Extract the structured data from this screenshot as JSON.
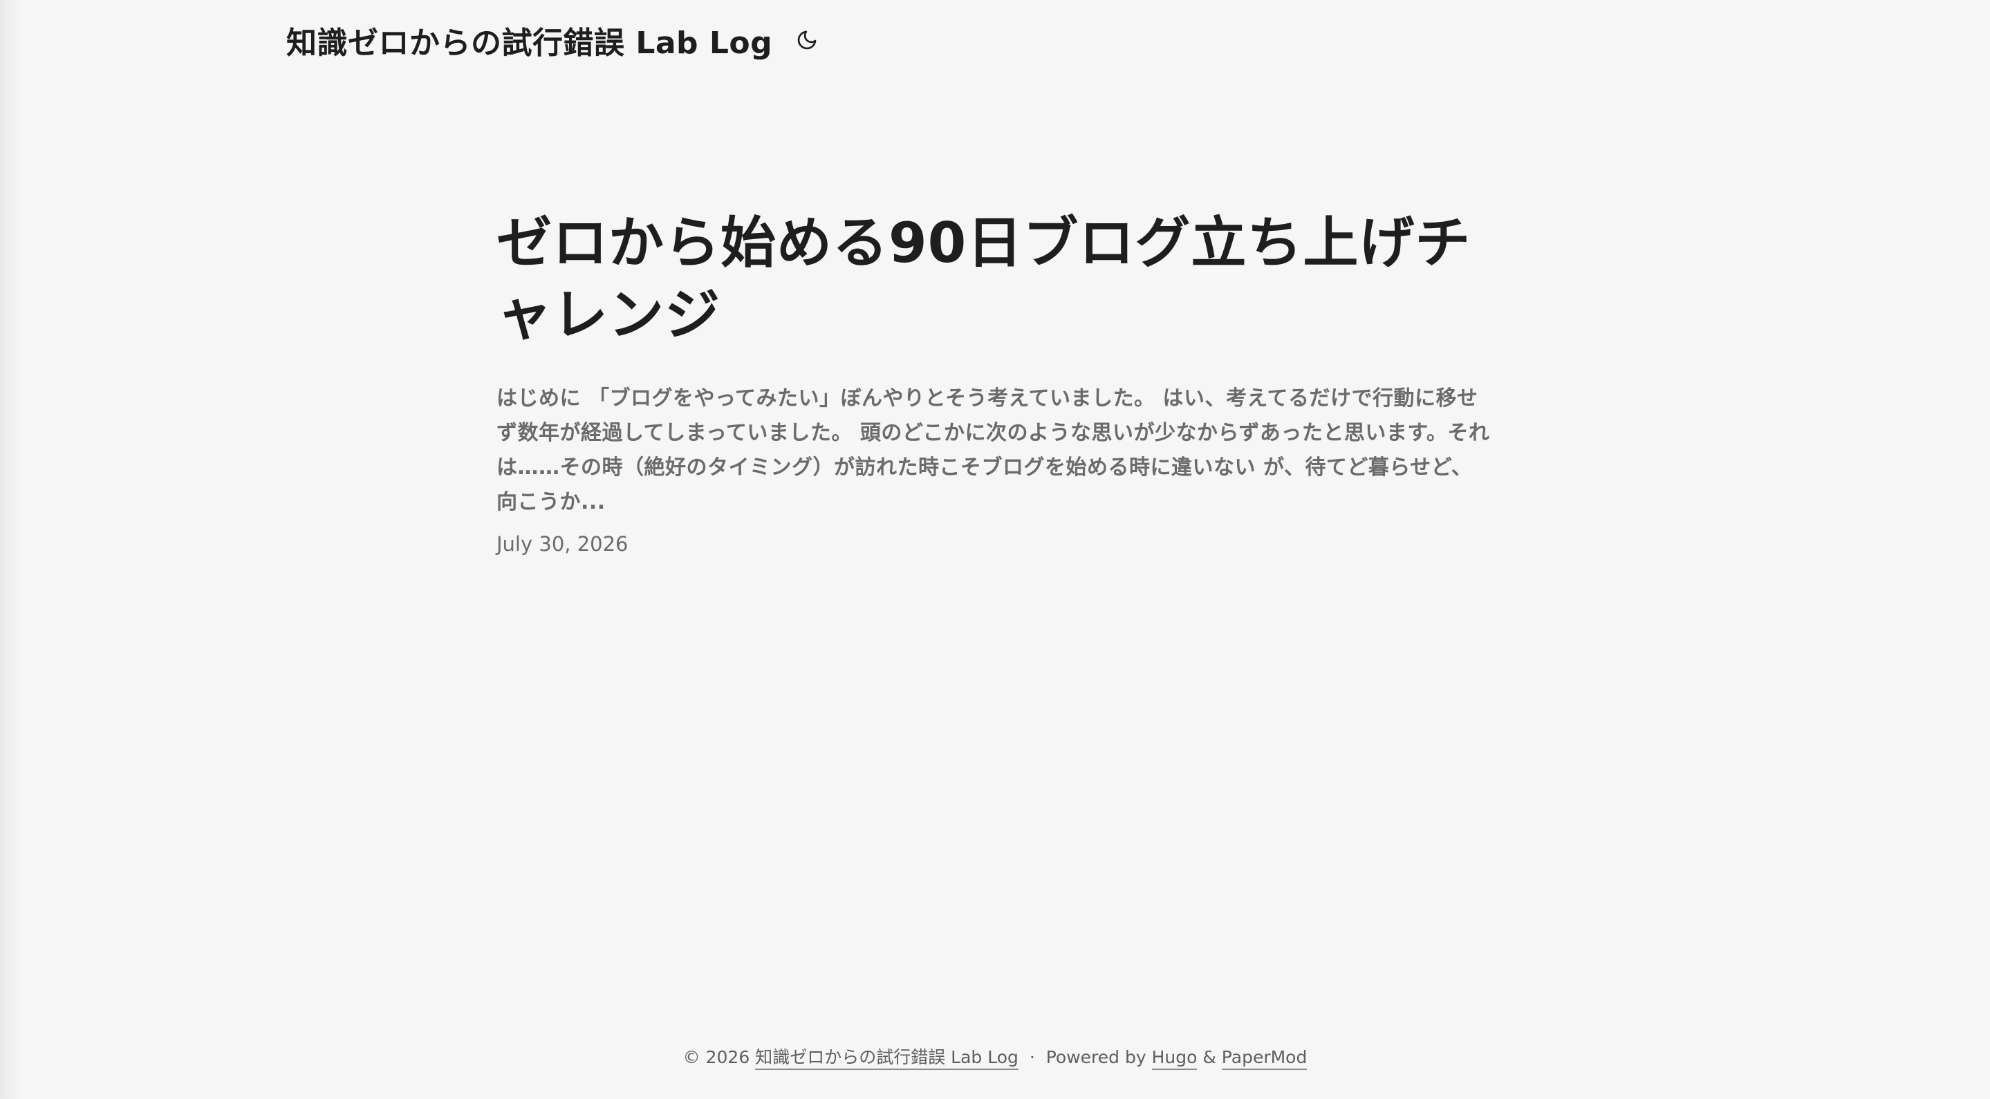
{
  "header": {
    "site_title": "知識ゼロからの試行錯誤 Lab Log",
    "theme_toggle_icon": "moon-icon"
  },
  "post": {
    "title": "ゼロから始める90日ブログ立ち上げチャレンジ",
    "summary": "はじめに 「ブログをやってみたい」ぼんやりとそう考えていました。 はい、考えてるだけで行動に移せず数年が経過してしまっていました。 頭のどこかに次のような思いが少なからずあったと思います。それは……その時（絶好のタイミング）が訪れた時こそブログを始める時に違いない が、待てど暮らせど、向こうか...",
    "date": "July 30, 2026"
  },
  "footer": {
    "copyright": "© 2026",
    "site_link": "知識ゼロからの試行錯誤 Lab Log",
    "separator": "·",
    "powered_by": "Powered by",
    "hugo_link": "Hugo",
    "ampersand": "&",
    "papermod_link": "PaperMod"
  }
}
